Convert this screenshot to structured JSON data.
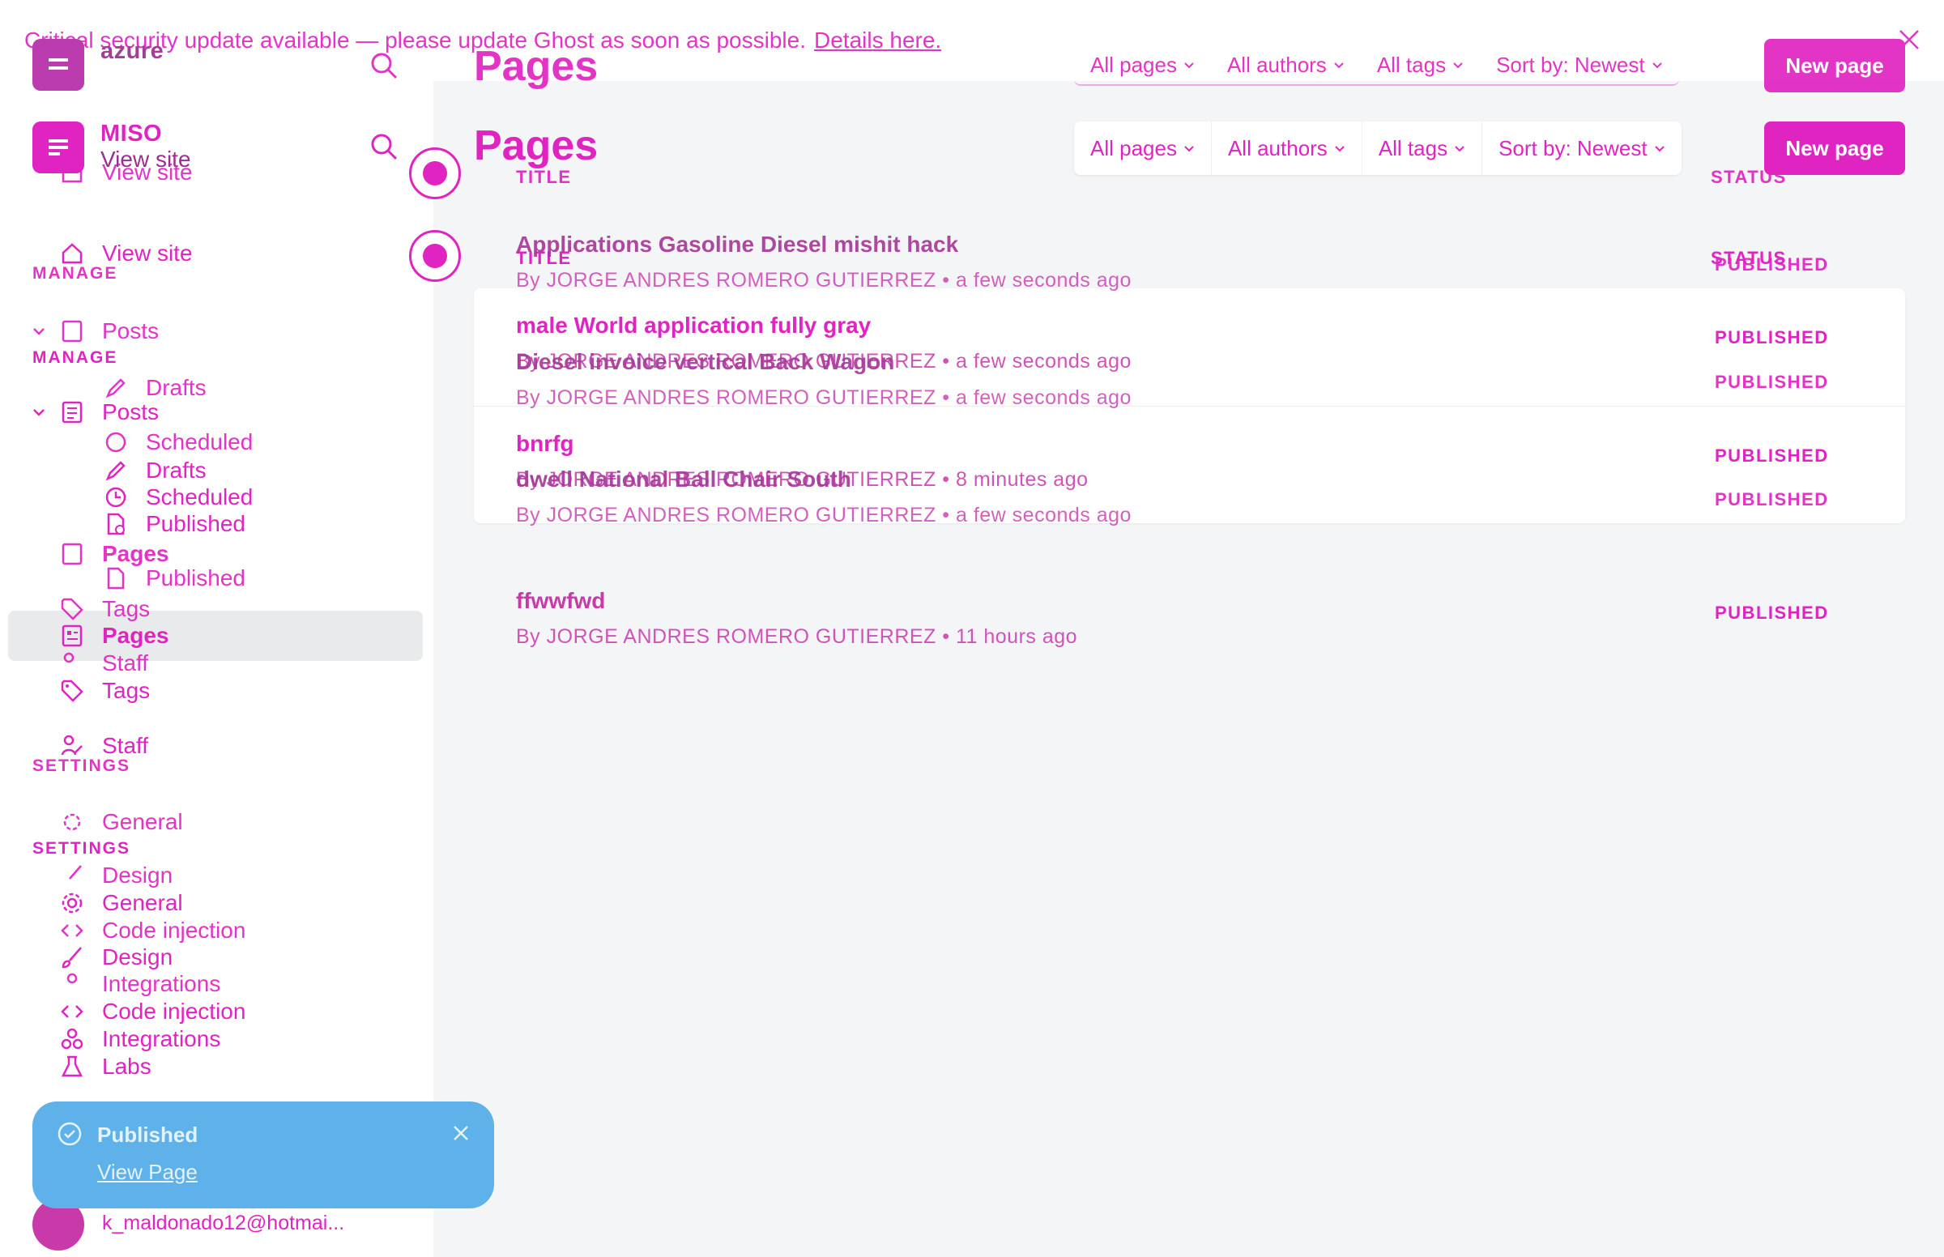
{
  "banner": {
    "message": "Critical security update available — please update Ghost as soon as possible.",
    "link": "Details here."
  },
  "site": {
    "name": "MISO",
    "ghost_name": "azure",
    "view_site": "View site"
  },
  "sidebar": {
    "manage_label": "MANAGE",
    "settings_label": "SETTINGS",
    "items": {
      "posts": "Posts",
      "drafts": "Drafts",
      "scheduled": "Scheduled",
      "published": "Published",
      "pages": "Pages",
      "tags": "Tags",
      "staff": "Staff",
      "general": "General",
      "design": "Design",
      "code_injection": "Code injection",
      "integrations": "Integrations",
      "labs": "Labs"
    }
  },
  "toast": {
    "title": "Published",
    "link": "View Page"
  },
  "user": {
    "email": "k_maldonado12@hotmai..."
  },
  "header": {
    "title": "Pages",
    "filters": [
      "All pages",
      "All authors",
      "All tags",
      "Sort by: Newest"
    ],
    "new_button": "New page"
  },
  "list": {
    "col_title": "TITLE",
    "col_status": "STATUS",
    "rows": [
      {
        "title": "male World application fully gray",
        "meta": "By JORGE ANDRES ROMERO GUTIERREZ • a few seconds ago",
        "status": "PUBLISHED"
      },
      {
        "title": "bnrfg",
        "meta": "By JORGE ANDRES ROMERO GUTIERREZ • 8 minutes ago",
        "status": "PUBLISHED"
      },
      {
        "title": "ffwwfwd",
        "meta": "By JORGE ANDRES ROMERO GUTIERREZ • 11 hours ago",
        "status": "PUBLISHED"
      }
    ],
    "ghost_rows": [
      {
        "title": "Applications Gasoline Diesel mishit hack",
        "meta": "By JORGE ANDRES ROMERO GUTIERREZ • a few seconds ago",
        "status": "PUBLISHED"
      },
      {
        "title": "Diesel invoice vertical Back Wagon",
        "meta": "By JORGE ANDRES ROMERO GUTIERREZ • a few seconds ago",
        "status": "PUBLISHED"
      },
      {
        "title": "dwell National Ball Chair South",
        "meta": "By JORGE ANDRES ROMERO GUTIERREZ • a few seconds ago",
        "status": "PUBLISHED"
      }
    ]
  },
  "colors": {
    "accent": "#e024c2",
    "toast": "#5fb1ea",
    "main_bg": "#f4f5f6"
  }
}
